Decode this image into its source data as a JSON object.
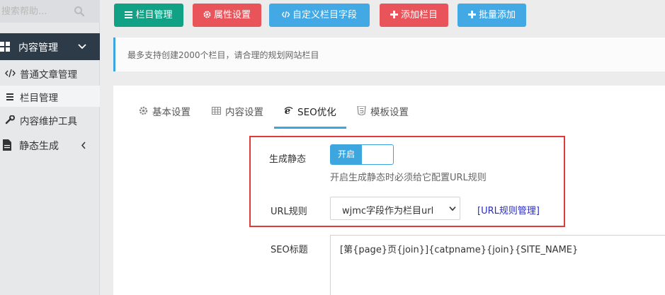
{
  "sidebar": {
    "search_placeholder": "搜索帮助...",
    "active_section": "内容管理",
    "sub_items": [
      {
        "label": "普通文章管理",
        "icon": "code-icon"
      },
      {
        "label": "栏目管理",
        "icon": "list-icon"
      },
      {
        "label": "内容维护工具",
        "icon": "wrench-icon"
      }
    ],
    "static_gen": "静态生成"
  },
  "toolbar": {
    "category_manage": "栏目管理",
    "attr_settings": "属性设置",
    "custom_fields": "自定义栏目字段",
    "add_category": "添加栏目",
    "batch_add": "批量添加"
  },
  "notice": "最多支持创建2000个栏目，请合理的规划网站栏目",
  "tabs": [
    {
      "label": "基本设置",
      "icon": "gear-icon"
    },
    {
      "label": "内容设置",
      "icon": "table-icon"
    },
    {
      "label": "SEO优化",
      "icon": "ie-icon",
      "active": true
    },
    {
      "label": "模板设置",
      "icon": "html5-icon"
    }
  ],
  "form": {
    "static_label": "生成静态",
    "toggle_on": "开启",
    "static_help": "开启生成静态时必须给它配置URL规则",
    "url_label": "URL规则",
    "url_select": "wjmc字段作为栏目url",
    "url_link": "[URL规则管理]",
    "seo_title_label": "SEO标题",
    "seo_title_value": "[第{page}页{join}]{catpname}{join}{SITE_NAME}"
  },
  "colors": {
    "green": "#11a286",
    "red": "#e9545b",
    "blue": "#43a9e4",
    "accent": "#3ea6de",
    "sidebar_active": "#2d3b48",
    "highlight_frame": "#e23a3a"
  }
}
